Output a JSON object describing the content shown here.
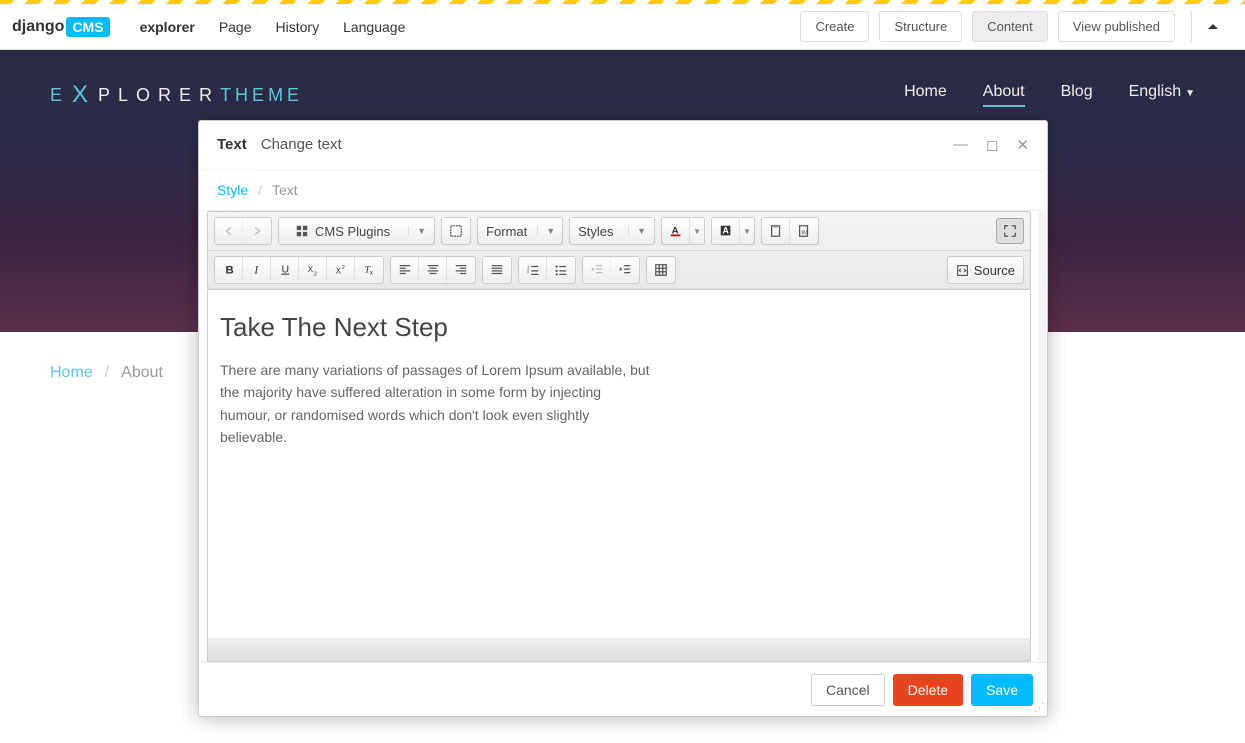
{
  "cms_toolbar": {
    "logo_part1": "django",
    "logo_part2": "CMS",
    "items": [
      "explorer",
      "Page",
      "History",
      "Language"
    ],
    "buttons": {
      "create": "Create",
      "structure": "Structure",
      "content": "Content",
      "view_published": "View published"
    }
  },
  "site": {
    "logo": {
      "e": "E",
      "x": "X",
      "plorer": "PLORER",
      "theme": "THEME"
    },
    "nav": {
      "home": "Home",
      "about": "About",
      "blog": "Blog",
      "language": "English"
    }
  },
  "breadcrumb": {
    "home": "Home",
    "current": "About"
  },
  "modal": {
    "title": "Text",
    "subtitle": "Change text",
    "tabs": {
      "style": "Style",
      "text": "Text"
    },
    "toolbar": {
      "cms_plugins": "CMS Plugins",
      "format": "Format",
      "styles": "Styles",
      "source": "Source"
    },
    "content": {
      "heading": "Take The Next Step",
      "body": "There are many variations of passages of Lorem Ipsum available, but the majority have suffered alteration in some form by injecting humour, or randomised words which don't look even slightly believable."
    },
    "footer": {
      "cancel": "Cancel",
      "delete": "Delete",
      "save": "Save"
    }
  }
}
